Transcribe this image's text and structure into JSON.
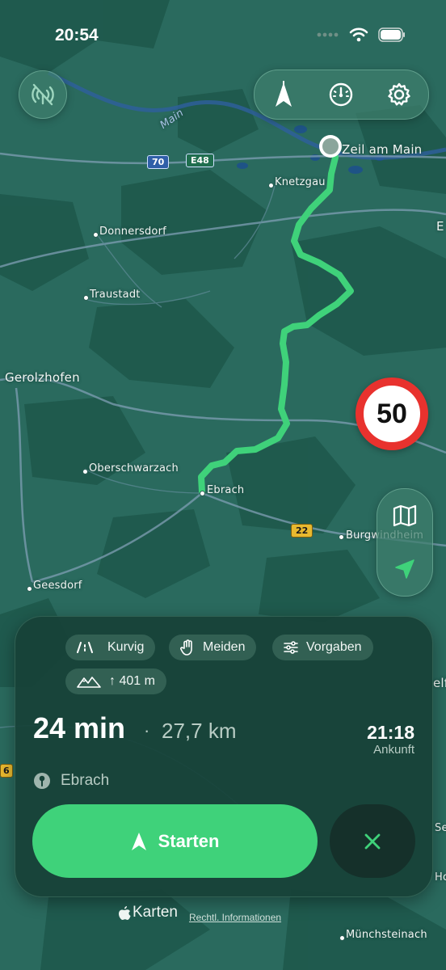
{
  "status_bar": {
    "time": "20:54"
  },
  "map": {
    "labels": {
      "zeil": "Zeil am Main",
      "knetzgau": "Knetzgau",
      "donnersdorf": "Donnersdorf",
      "traustadt": "Traustadt",
      "gerolzhofen": "Gerolzhofen",
      "oberschwarzach": "Oberschwarzach",
      "ebrach": "Ebrach",
      "burgwindheim": "Burgwindheim",
      "geesdorf": "Geesdorf",
      "muenchsteinach": "Münchsteinach",
      "main_river": "Main",
      "edge_e": "E",
      "edge_elfe": "elfe",
      "edge_se": "Se",
      "edge_ho": "Ho",
      "edge_6": "6"
    },
    "shields": {
      "a70": "70",
      "e48": "E48",
      "b22": "22"
    }
  },
  "controls": {
    "offline_icon": "no-signal-icon",
    "speed_limit": "50"
  },
  "route": {
    "chips": {
      "curvy": "Kurvig",
      "avoid": "Meiden",
      "preferences": "Vorgaben",
      "elevation": "↑ 401 m"
    },
    "duration": "24 min",
    "separator": "·",
    "distance": "27,7 km",
    "arrival_time": "21:18",
    "arrival_label": "Ankunft",
    "destination": "Ebrach",
    "start_label": "Starten"
  },
  "footer": {
    "brand": "Karten",
    "legal": "Rechtl. Informationen"
  },
  "colors": {
    "route": "#3fd27a",
    "map": "#2a6a5e",
    "speed_ring": "#e8322e"
  }
}
